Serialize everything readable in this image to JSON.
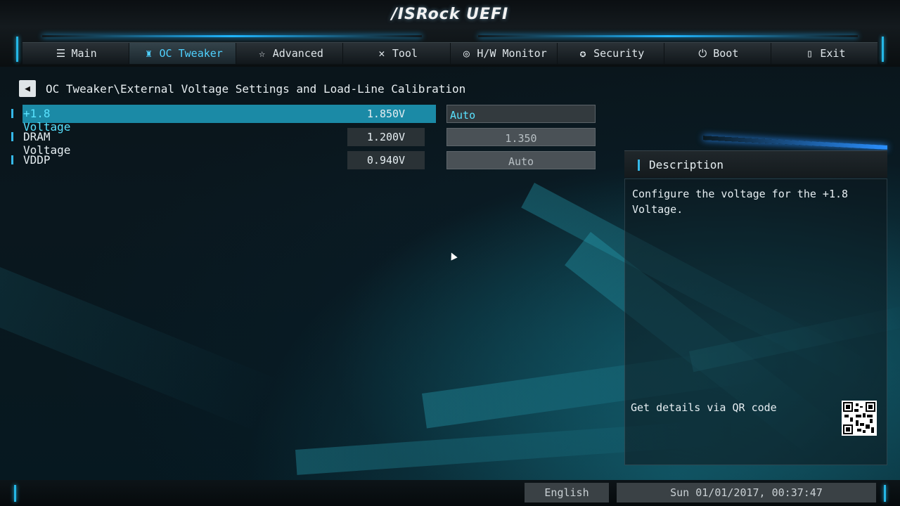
{
  "app": {
    "logo": "/ISRock UEFI"
  },
  "nav": {
    "tabs": [
      {
        "label": "Main",
        "icon": "list-icon"
      },
      {
        "label": "OC Tweaker",
        "icon": "rocket-icon"
      },
      {
        "label": "Advanced",
        "icon": "star-icon"
      },
      {
        "label": "Tool",
        "icon": "tools-icon"
      },
      {
        "label": "H/W Monitor",
        "icon": "monitor-icon"
      },
      {
        "label": "Security",
        "icon": "shield-icon"
      },
      {
        "label": "Boot",
        "icon": "power-icon"
      },
      {
        "label": "Exit",
        "icon": "exit-icon"
      }
    ],
    "active": "OC Tweaker"
  },
  "breadcrumb": {
    "path": "OC Tweaker\\External Voltage Settings and Load-Line Calibration"
  },
  "settings": [
    {
      "label": "+1.8 Voltage",
      "current": "1.850V",
      "option": "Auto"
    },
    {
      "label": "DRAM Voltage",
      "current": "1.200V",
      "option": "1.350"
    },
    {
      "label": "VDDP",
      "current": "0.940V",
      "option": "Auto"
    }
  ],
  "description": {
    "title": "Description",
    "text": "Configure the voltage for the +1.8 Voltage.",
    "qr_label": "Get details via QR code"
  },
  "status": {
    "language": "English",
    "datetime": "Sun 01/01/2017, 00:37:47"
  },
  "colors": {
    "accent": "#35b8e8",
    "selected_row": "#1b8aa6",
    "selected_text": "#59e3ff"
  }
}
